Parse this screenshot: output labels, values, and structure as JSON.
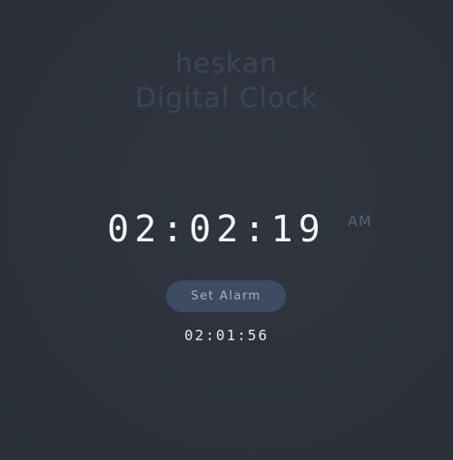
{
  "header": {
    "brand": "heskan",
    "title": "Digital Clock"
  },
  "clock": {
    "time": "02:02:19",
    "meridiem": "AM"
  },
  "alarm": {
    "button_label": "Set Alarm",
    "time": "02:01:56"
  },
  "colors": {
    "background": "#2c313b",
    "title_text": "#3b4455",
    "clock_text": "#f4f6f9",
    "meridiem_text": "#55637b",
    "button_bg": "#3d4b63",
    "button_text": "#a9b4c6",
    "alarm_text": "#e6eaf0"
  }
}
